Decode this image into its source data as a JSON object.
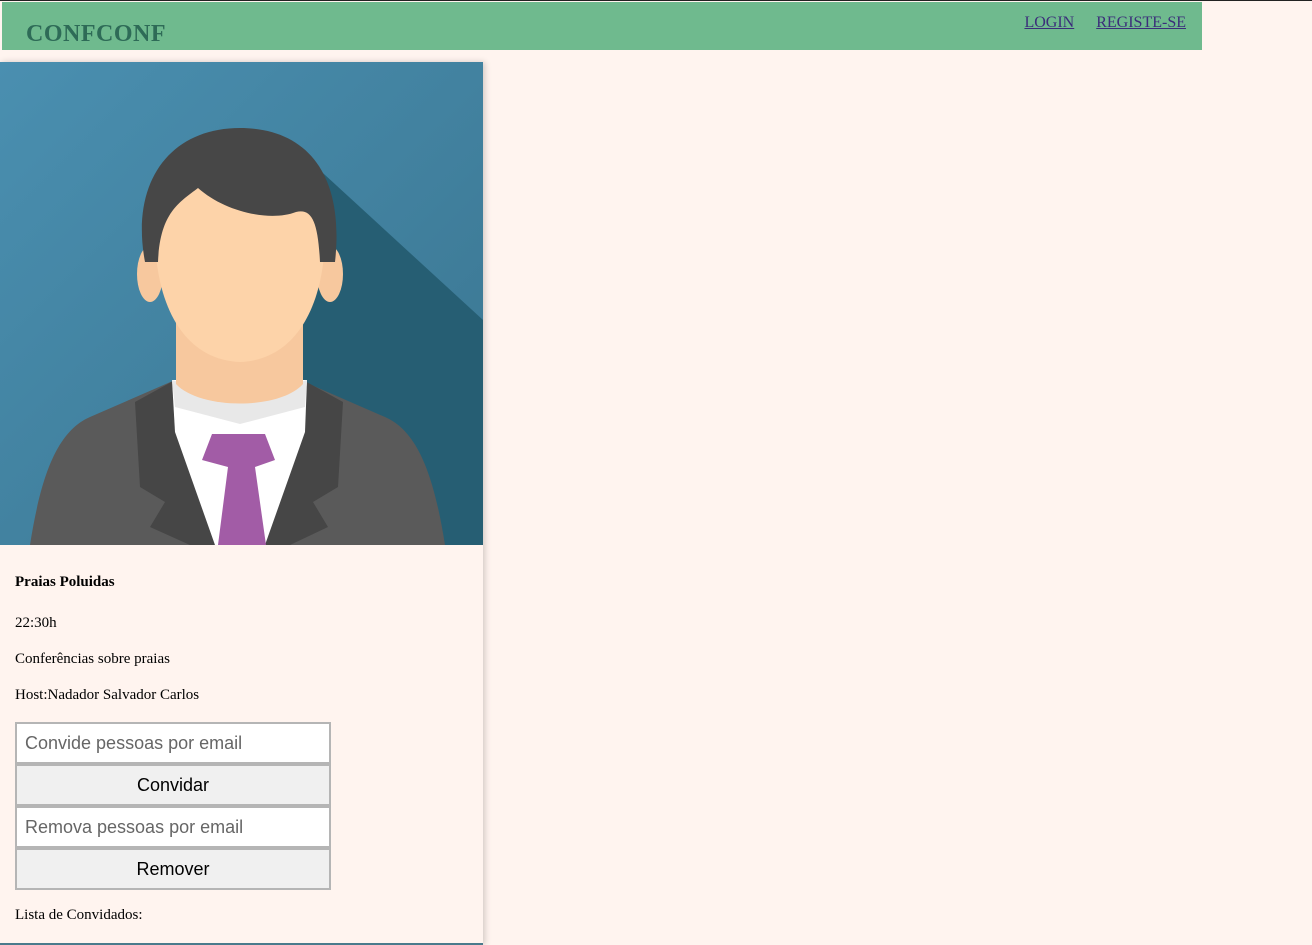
{
  "navbar": {
    "brand": "CONFCONF",
    "links": [
      "LOGIN",
      "REGISTE-SE"
    ]
  },
  "event": {
    "image": "host-avatar-illustration",
    "title": "Praias Poluidas",
    "time": "22:30h",
    "description": "Conferências sobre praias",
    "host": "Host:Nadador Salvador Carlos"
  },
  "invite": {
    "placeholder": "Convide pessoas por email",
    "button": "Convidar"
  },
  "remove": {
    "placeholder": "Remova pessoas por email",
    "button": "Remover"
  },
  "guest_list_label": "Lista de Convidados:",
  "colors": {
    "navbar": "#6fba8e",
    "brand": "#2e6b57",
    "background": "#fff4ef",
    "avatar_bg": "#4a8fb0"
  }
}
